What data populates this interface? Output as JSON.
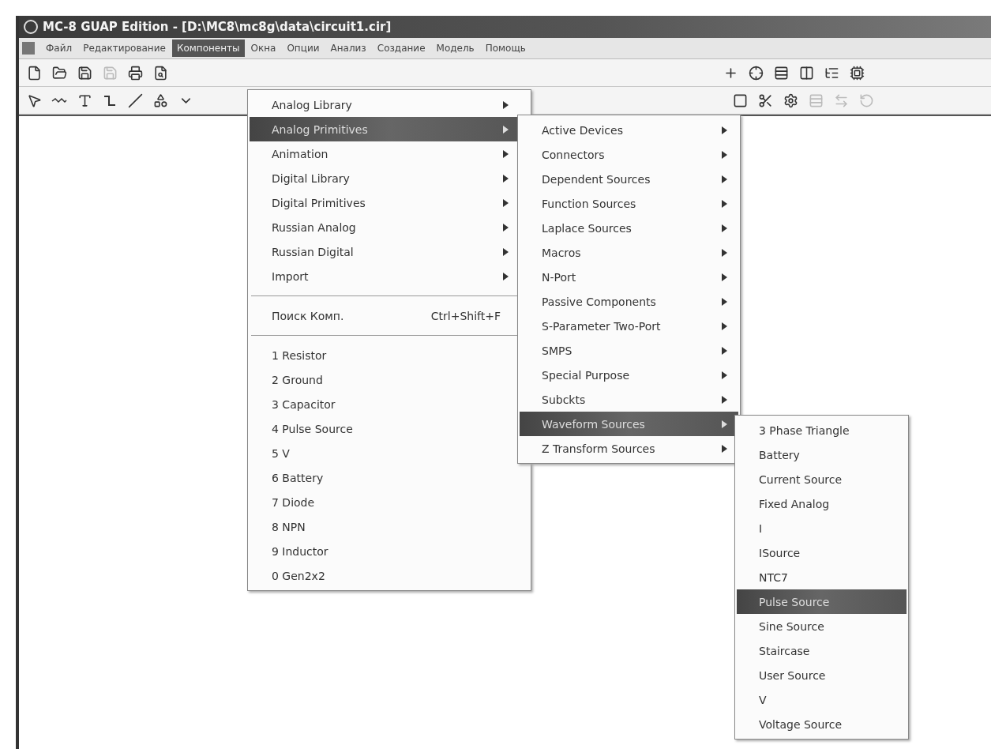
{
  "window": {
    "title": "MC-8 GUAP Edition - [D:\\MC8\\mc8g\\data\\circuit1.cir]"
  },
  "menu_bar": [
    {
      "label": "Файл",
      "selected": false
    },
    {
      "label": "Редактирование",
      "selected": false
    },
    {
      "label": "Компоненты",
      "selected": true
    },
    {
      "label": "Окна",
      "selected": false
    },
    {
      "label": "Опции",
      "selected": false
    },
    {
      "label": "Анализ",
      "selected": false
    },
    {
      "label": "Создание",
      "selected": false
    },
    {
      "label": "Модель",
      "selected": false
    },
    {
      "label": "Помощь",
      "selected": false
    }
  ],
  "components_menu": [
    {
      "kind": "submenu",
      "label": "Analog Library",
      "selected": false
    },
    {
      "kind": "submenu",
      "label": "Analog Primitives",
      "selected": true
    },
    {
      "kind": "submenu",
      "label": "Animation",
      "selected": false
    },
    {
      "kind": "submenu",
      "label": "Digital Library",
      "selected": false
    },
    {
      "kind": "submenu",
      "label": "Digital Primitives",
      "selected": false
    },
    {
      "kind": "submenu",
      "label": "Russian Analog",
      "selected": false
    },
    {
      "kind": "submenu",
      "label": "Russian Digital",
      "selected": false
    },
    {
      "kind": "submenu",
      "label": "Import",
      "selected": false
    },
    {
      "kind": "separator"
    },
    {
      "kind": "command",
      "label": "Поиск Комп.",
      "shortcut": "Ctrl+Shift+F",
      "selected": false
    },
    {
      "kind": "separator"
    },
    {
      "kind": "command",
      "label": "1 Resistor",
      "selected": false
    },
    {
      "kind": "command",
      "label": "2 Ground",
      "selected": false
    },
    {
      "kind": "command",
      "label": "3 Capacitor",
      "selected": false
    },
    {
      "kind": "command",
      "label": "4 Pulse Source",
      "selected": false
    },
    {
      "kind": "command",
      "label": "5 V",
      "selected": false
    },
    {
      "kind": "command",
      "label": "6 Battery",
      "selected": false
    },
    {
      "kind": "command",
      "label": "7 Diode",
      "selected": false
    },
    {
      "kind": "command",
      "label": "8 NPN",
      "selected": false
    },
    {
      "kind": "command",
      "label": "9 Inductor",
      "selected": false
    },
    {
      "kind": "command",
      "label": "0 Gen2x2",
      "selected": false
    }
  ],
  "analog_primitives_menu": [
    {
      "kind": "submenu",
      "label": "Active Devices",
      "selected": false
    },
    {
      "kind": "submenu",
      "label": "Connectors",
      "selected": false
    },
    {
      "kind": "submenu",
      "label": "Dependent Sources",
      "selected": false
    },
    {
      "kind": "submenu",
      "label": "Function Sources",
      "selected": false
    },
    {
      "kind": "submenu",
      "label": "Laplace Sources",
      "selected": false
    },
    {
      "kind": "submenu",
      "label": "Macros",
      "selected": false
    },
    {
      "kind": "submenu",
      "label": "N-Port",
      "selected": false
    },
    {
      "kind": "submenu",
      "label": "Passive Components",
      "selected": false
    },
    {
      "kind": "submenu",
      "label": "S-Parameter Two-Port",
      "selected": false
    },
    {
      "kind": "submenu",
      "label": "SMPS",
      "selected": false
    },
    {
      "kind": "submenu",
      "label": "Special Purpose",
      "selected": false
    },
    {
      "kind": "submenu",
      "label": "Subckts",
      "selected": false
    },
    {
      "kind": "submenu",
      "label": "Waveform Sources",
      "selected": true
    },
    {
      "kind": "submenu",
      "label": "Z Transform Sources",
      "selected": false
    }
  ],
  "waveform_sources_menu": [
    {
      "kind": "command",
      "label": "3 Phase Triangle",
      "selected": false
    },
    {
      "kind": "command",
      "label": "Battery",
      "selected": false
    },
    {
      "kind": "command",
      "label": "Current Source",
      "selected": false
    },
    {
      "kind": "command",
      "label": "Fixed Analog",
      "selected": false
    },
    {
      "kind": "command",
      "label": "I",
      "selected": false
    },
    {
      "kind": "command",
      "label": "ISource",
      "selected": false
    },
    {
      "kind": "command",
      "label": "NTC7",
      "selected": false
    },
    {
      "kind": "command",
      "label": "Pulse Source",
      "selected": true
    },
    {
      "kind": "command",
      "label": "Sine Source",
      "selected": false
    },
    {
      "kind": "command",
      "label": "Staircase",
      "selected": false
    },
    {
      "kind": "command",
      "label": "User Source",
      "selected": false
    },
    {
      "kind": "command",
      "label": "V",
      "selected": false
    },
    {
      "kind": "command",
      "label": "Voltage Source",
      "selected": false
    }
  ]
}
